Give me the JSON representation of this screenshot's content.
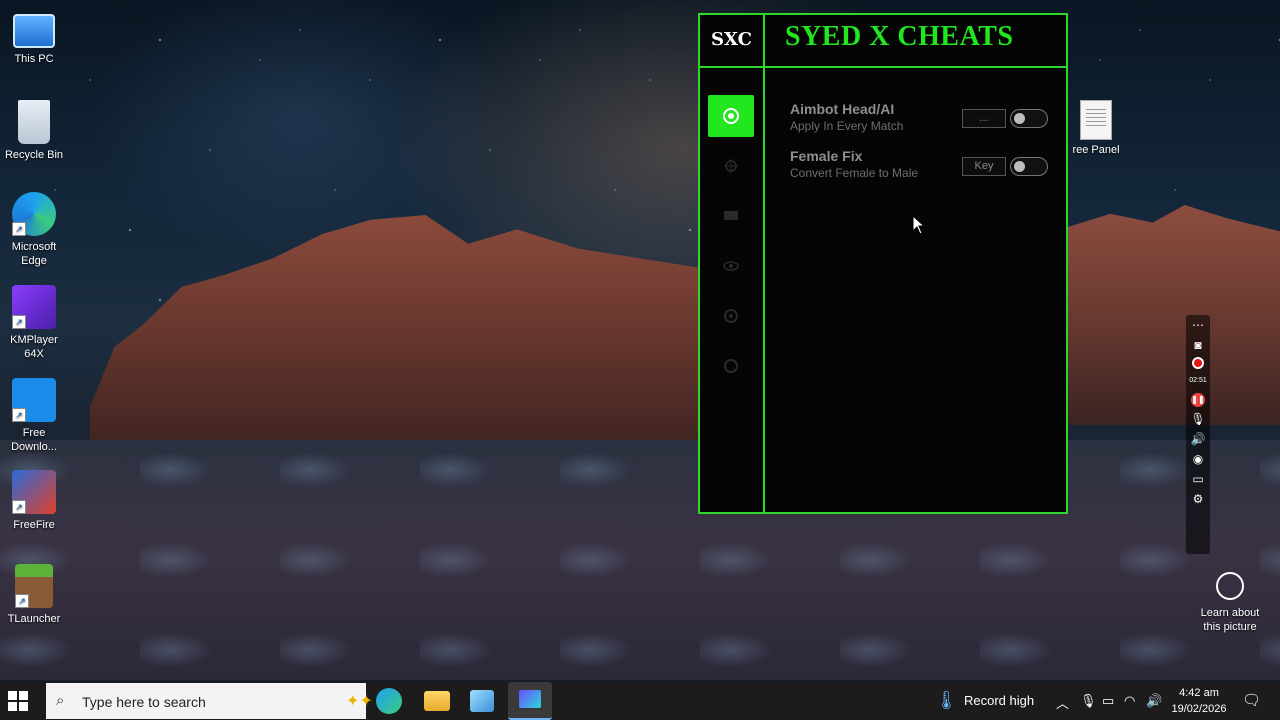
{
  "desktop": {
    "icons": [
      {
        "label": "This PC",
        "icon": "computer-icon"
      },
      {
        "label": "Recycle Bin",
        "icon": "recycle-bin-icon"
      },
      {
        "label": "Microsoft Edge",
        "icon": "edge-icon"
      },
      {
        "label": "KMPlayer 64X",
        "icon": "kmplayer-icon"
      },
      {
        "label": "Free Downlo...",
        "icon": "fdm-icon"
      },
      {
        "label": "FreeFire",
        "icon": "freefire-icon"
      },
      {
        "label": "TLauncher",
        "icon": "minecraft-block-icon"
      }
    ],
    "right_file": {
      "label": "ree Panel",
      "icon": "text-file-icon"
    }
  },
  "cheat_window": {
    "logo": "SXC",
    "title": "SYED X CHEATS",
    "accent": "#22e61e",
    "nav": [
      {
        "icon": "target-icon",
        "active": true
      },
      {
        "icon": "crosshair-icon",
        "active": false
      },
      {
        "icon": "monitor-icon",
        "active": false
      },
      {
        "icon": "eye-icon",
        "active": false
      },
      {
        "icon": "settings-icon",
        "active": false
      },
      {
        "icon": "info-icon",
        "active": false
      }
    ],
    "features": [
      {
        "name": "Aimbot Head/AI",
        "desc": "Apply In Every Match",
        "key": "...",
        "enabled": false
      },
      {
        "name": "Female Fix",
        "desc": "Convert Female to Male",
        "key": "Key",
        "enabled": false
      }
    ]
  },
  "recorder": {
    "time": "02:51"
  },
  "learn_about": "Learn about this picture",
  "taskbar": {
    "search_placeholder": "Type here to search",
    "weather": "Record high",
    "time": "4:42 am",
    "date": "19/02/2026"
  }
}
